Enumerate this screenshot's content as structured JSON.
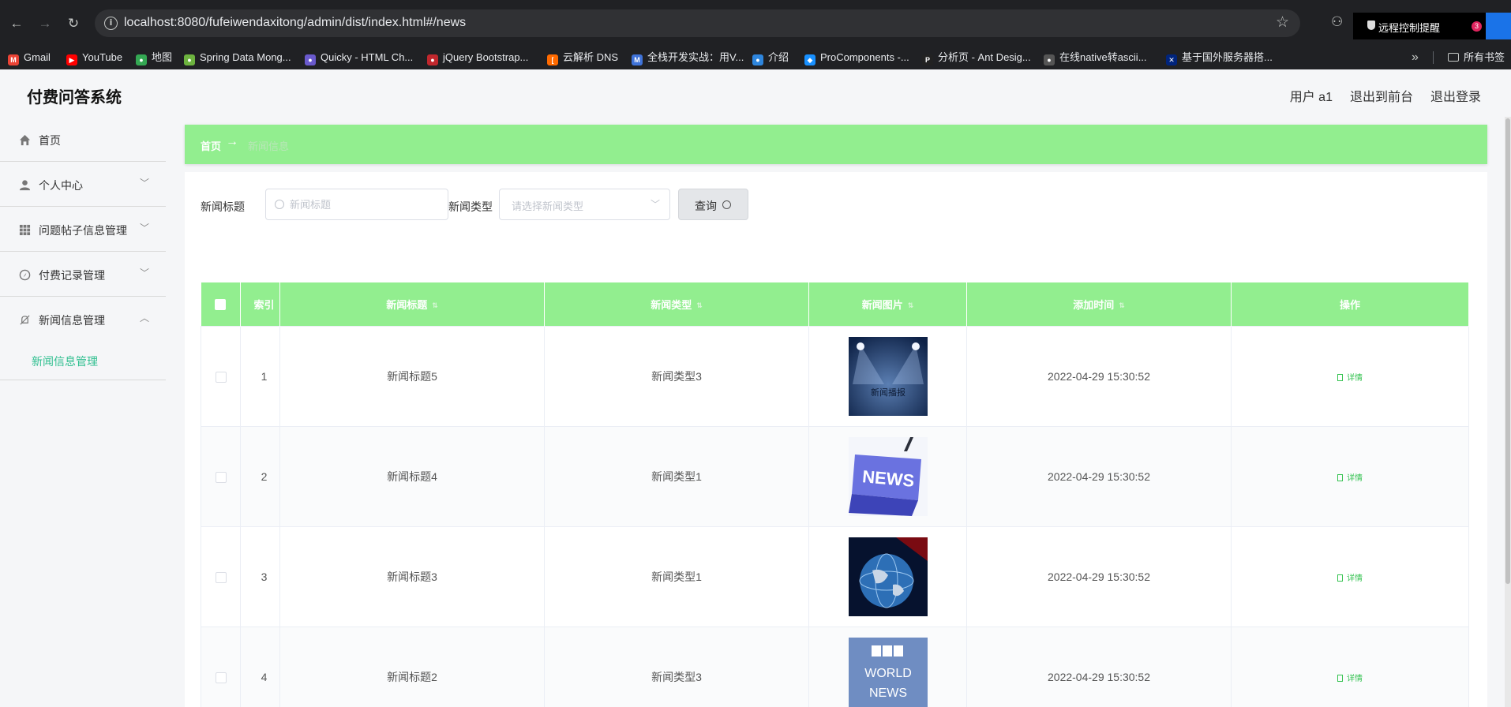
{
  "browser": {
    "url": "localhost:8080/fufeiwendaxitong/admin/dist/index.html#/news",
    "remote_notice": "远程控制提醒",
    "remote_badge": "3",
    "bookmarks": [
      {
        "label": "Gmail",
        "color": "#ea4335",
        "glyph": "M"
      },
      {
        "label": "YouTube",
        "color": "#ff0000",
        "glyph": "▶"
      },
      {
        "label": "地图",
        "color": "#34a853",
        "glyph": "●"
      },
      {
        "label": "Spring Data Mong...",
        "color": "#6db33f",
        "glyph": "●"
      },
      {
        "label": "Quicky - HTML Ch...",
        "color": "#6a5acd",
        "glyph": "●"
      },
      {
        "label": "jQuery Bootstrap...",
        "color": "#c1272d",
        "glyph": "●"
      },
      {
        "label": "云解析 DNS",
        "color": "#ff6a00",
        "glyph": "["
      },
      {
        "label": "全栈开发实战：用V...",
        "color": "#3f73d9",
        "glyph": "M"
      },
      {
        "label": "介绍",
        "color": "#2e86de",
        "glyph": "●"
      },
      {
        "label": "ProComponents -...",
        "color": "#1890ff",
        "glyph": "◆"
      },
      {
        "label": "分析页 - Ant Desig...",
        "color": "#222222",
        "glyph": "P"
      },
      {
        "label": "在线native转ascii...",
        "color": "#555555",
        "glyph": "●"
      },
      {
        "label": "基于国外服务器搭...",
        "color": "#00247d",
        "glyph": "✕"
      }
    ],
    "all_bookmarks": "所有书签"
  },
  "header": {
    "app_title": "付费问答系统",
    "user": "用户 a1",
    "back_front": "退出到前台",
    "logout": "退出登录"
  },
  "sidebar": {
    "items": [
      {
        "label": "首页",
        "icon": "home-icon"
      },
      {
        "label": "个人中心",
        "icon": "user-icon"
      },
      {
        "label": "问题帖子信息管理",
        "icon": "grid-icon"
      },
      {
        "label": "付费记录管理",
        "icon": "compass-icon"
      },
      {
        "label": "新闻信息管理",
        "icon": "bell-off-icon"
      }
    ],
    "submenu_active": "新闻信息管理"
  },
  "breadcrumb": {
    "home": "首页",
    "arrow": "→",
    "current": "新闻信息"
  },
  "search": {
    "title_label": "新闻标题",
    "title_placeholder": "新闻标题",
    "type_label": "新闻类型",
    "type_placeholder": "请选择新闻类型",
    "query_label": "查询"
  },
  "table": {
    "columns": [
      "索引",
      "新闻标题",
      "新闻类型",
      "新闻图片",
      "添加时间",
      "操作"
    ],
    "rows": [
      {
        "index": "1",
        "title": "新闻标题5",
        "type": "新闻类型3",
        "time": "2022-04-29 15:30:52",
        "action": "详情",
        "image": "spotlight-news"
      },
      {
        "index": "2",
        "title": "新闻标题4",
        "type": "新闻类型1",
        "time": "2022-04-29 15:30:52",
        "action": "详情",
        "image": "news-key",
        "image_text": "NEWS"
      },
      {
        "index": "3",
        "title": "新闻标题3",
        "type": "新闻类型1",
        "time": "2022-04-29 15:30:52",
        "action": "详情",
        "image": "globe"
      },
      {
        "index": "4",
        "title": "新闻标题2",
        "type": "新闻类型3",
        "time": "2022-04-29 15:30:52",
        "action": "详情",
        "image": "bbc-world-news",
        "image_text": "BBC WORLD NEWS"
      }
    ]
  },
  "colors": {
    "accent_green": "#92ee8f",
    "active_text": "#2fbf8f",
    "link_green": "#33c24f"
  }
}
